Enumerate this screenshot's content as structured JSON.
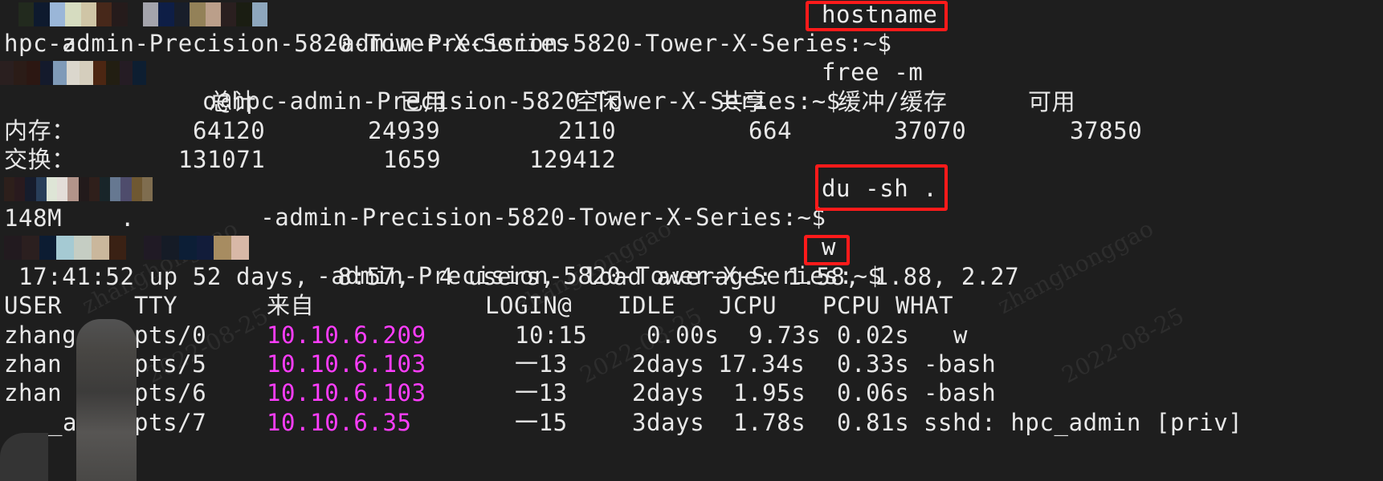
{
  "terminal": {
    "prompt_host_path": "@hpc-admin-Precision-5820-Tower-X-Series:~$",
    "prompt_suffix_after_user": "-admin-Precision-5820-Tower-X-Series:~$",
    "username_visible_prefix": "zhang",
    "commands": {
      "hostname": "hostname",
      "free": "free -m",
      "du": "du -sh .",
      "w": "w"
    },
    "prompt_lines": {
      "p1": "z",
      "p1_rest": "hpc-admin-Precision-5820-Tower-X-Series:~$",
      "p2_rest": "o@hpc-admin-Precision-5820-Tower-X-Series:~$",
      "p3_rest": "-admin-Precision-5820-Tower-X-Series:~$",
      "p4_rest": "-admin-Precision-5820-Tower-X-Series:~$"
    },
    "hostname_output": "hpc-admin-Precision-5820-Tower-X-Series",
    "free": {
      "headers": [
        "总计",
        "已用",
        "空闲",
        "共享",
        "缓冲/缓存",
        "可用"
      ],
      "rows": [
        {
          "label": "内存：",
          "values": [
            "64120",
            "24939",
            "2110",
            "664",
            "37070",
            "37850"
          ]
        },
        {
          "label": "交换：",
          "values": [
            "131071",
            "1659",
            "129412"
          ]
        }
      ]
    },
    "du_output": {
      "size": "148M",
      "path": "."
    },
    "w": {
      "summary": " 17:41:52 up 52 days,  8:57,  4 users,  load average: 1.58, 1.88, 2.27",
      "headers": [
        "USER",
        "TTY",
        "来自",
        "LOGIN@",
        "IDLE",
        "JCPU",
        "PCPU",
        "WHAT"
      ],
      "rows": [
        {
          "user": "zhang",
          "tty": "pts/0",
          "from": "10.10.6.209",
          "login": "10:15",
          "idle": "0.00s",
          "jcpu": "9.73s",
          "pcpu": "0.02s",
          "what": "w"
        },
        {
          "user": "zhan",
          "tty": "pts/5",
          "from": "10.10.6.103",
          "login": "一13",
          "idle": "2days",
          "jcpu": "17.34s",
          "pcpu": "0.33s",
          "what": "-bash"
        },
        {
          "user": "zhan",
          "tty": "pts/6",
          "from": "10.10.6.103",
          "login": "一13",
          "idle": "2days",
          "jcpu": "1.95s",
          "pcpu": "0.06s",
          "what": "-bash"
        },
        {
          "user": "_a",
          "tty": "pts/7",
          "from": "10.10.6.35",
          "login": "一15",
          "idle": "3days",
          "jcpu": "1.78s",
          "pcpu": "0.81s",
          "what": "sshd: hpc_admin [priv]"
        }
      ]
    },
    "watermark": {
      "name": "zhanghonggao",
      "date": "2022-08-25"
    }
  },
  "colors": {
    "background": "#1e1e1e",
    "text": "#e8e8e8",
    "ip": "#ff3dff",
    "highlight_box": "#ff1a1a"
  }
}
